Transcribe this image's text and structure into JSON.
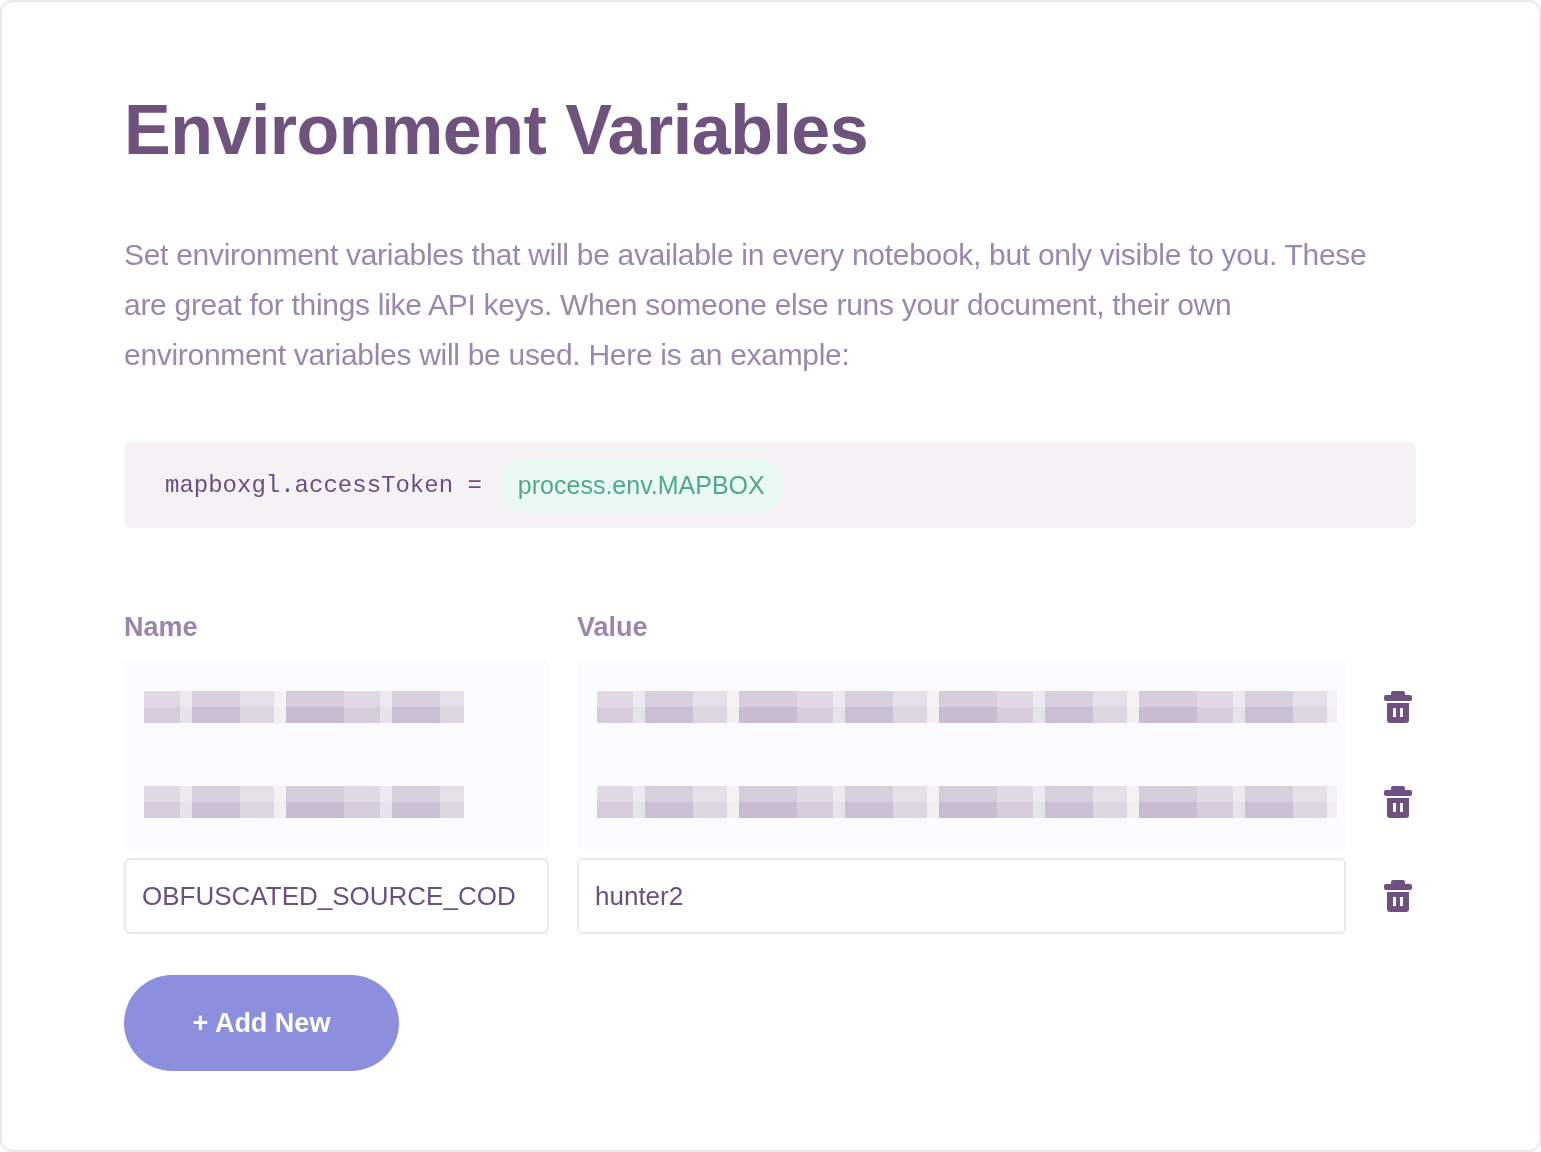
{
  "title": "Environment Variables",
  "description": "Set environment variables that will be available in every notebook, but only visible to you. These are great for things like API keys. When someone else runs your document, their own environment variables will be used. Here is an example:",
  "code_example": {
    "code": "mapboxgl.accessToken =",
    "token": "process.env.MAPBOX"
  },
  "table": {
    "columns": [
      "Name",
      "Value"
    ],
    "rows": [
      {
        "blurred": true
      },
      {
        "blurred": true
      },
      {
        "blurred": false,
        "name": "OBFUSCATED_SOURCE_COD",
        "value": "hunter2"
      }
    ]
  },
  "add_button": "+ Add New"
}
